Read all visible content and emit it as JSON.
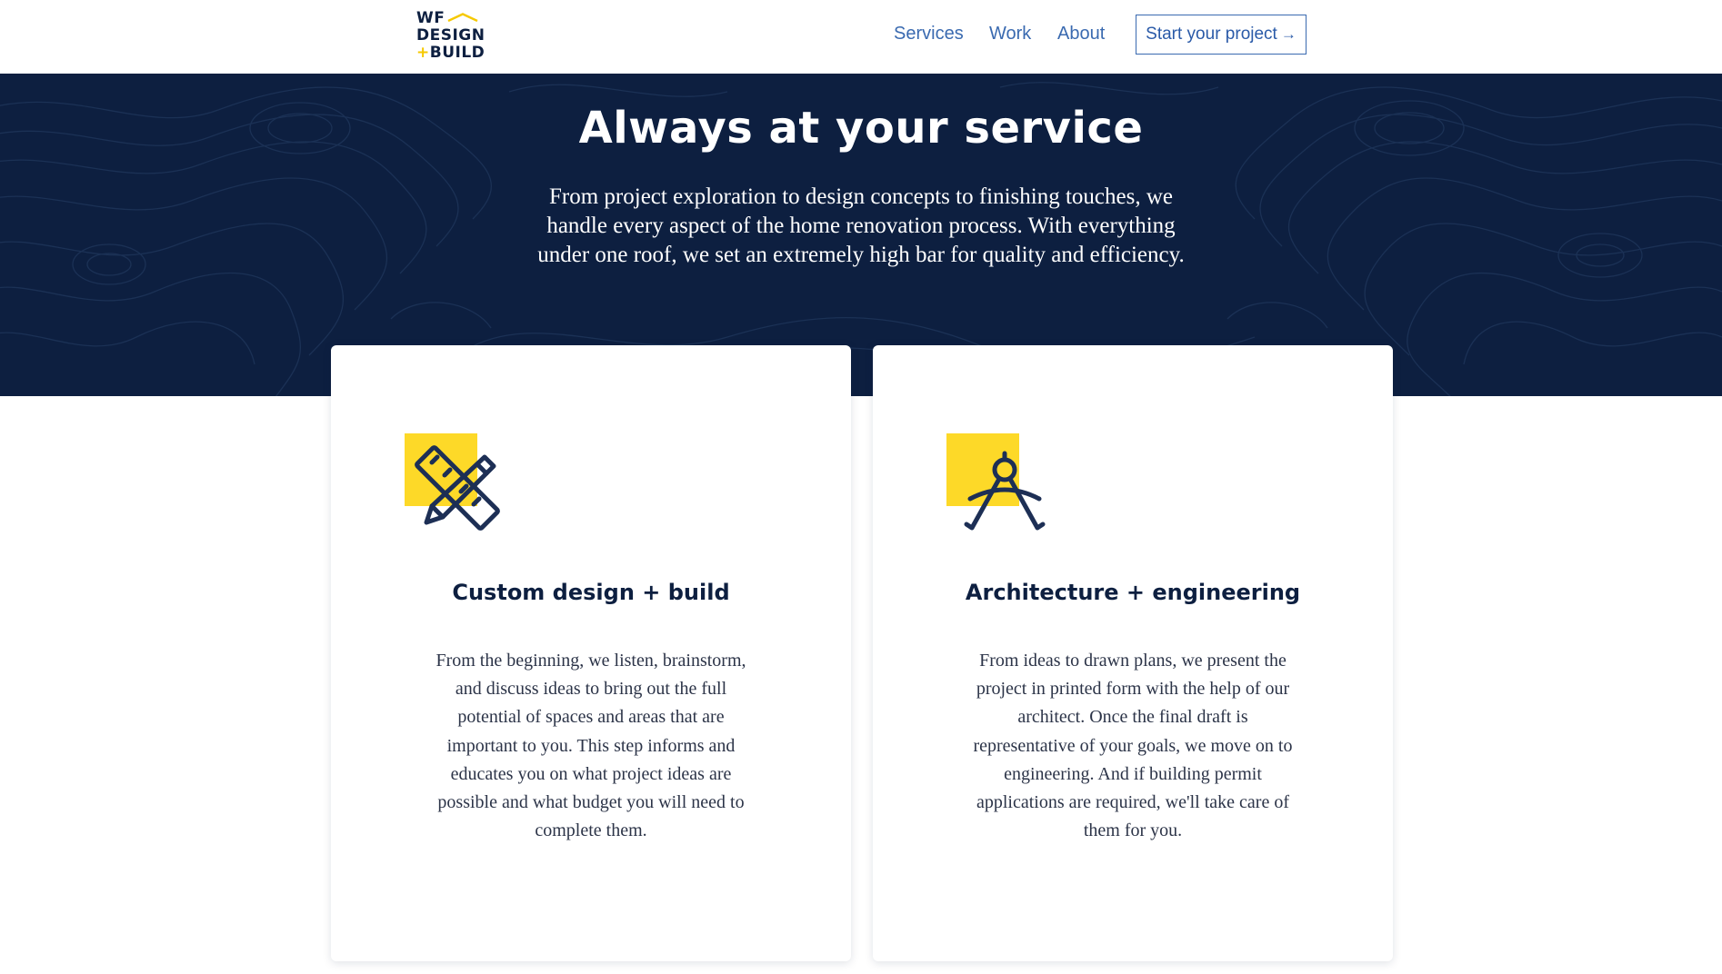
{
  "header": {
    "logo": {
      "line1": "WF",
      "line2": "DESIGN",
      "line3_plus": "+",
      "line3": "BUILD"
    },
    "nav": [
      {
        "label": "Services"
      },
      {
        "label": "Work"
      },
      {
        "label": "About"
      }
    ],
    "cta": {
      "label": "Start your project",
      "arrow": "→"
    }
  },
  "hero": {
    "title": "Always at your service",
    "text": "From project exploration to design concepts to finishing touches, we handle every aspect of the home renovation process. With everything under one roof, we set an extremely high bar for quality and efficiency."
  },
  "cards": [
    {
      "icon": "pencil-ruler-icon",
      "title": "Custom design + build",
      "text": "From the beginning, we listen, brainstorm, and discuss ideas to bring out the full potential of spaces and areas that are important to you. This step informs and educates you on what project ideas are possible and what budget you will need to complete them."
    },
    {
      "icon": "compass-icon",
      "title": "Architecture + engineering",
      "text": "From ideas to drawn plans, we present the project in printed form with the help of our architect. Once the final draft is representative of your goals, we move on to engineering. And if building permit applications are required, we'll take care of them for you."
    }
  ],
  "colors": {
    "navy": "#0d1f40",
    "accent_yellow": "#fdd928",
    "link_blue": "#3a6ab0"
  }
}
